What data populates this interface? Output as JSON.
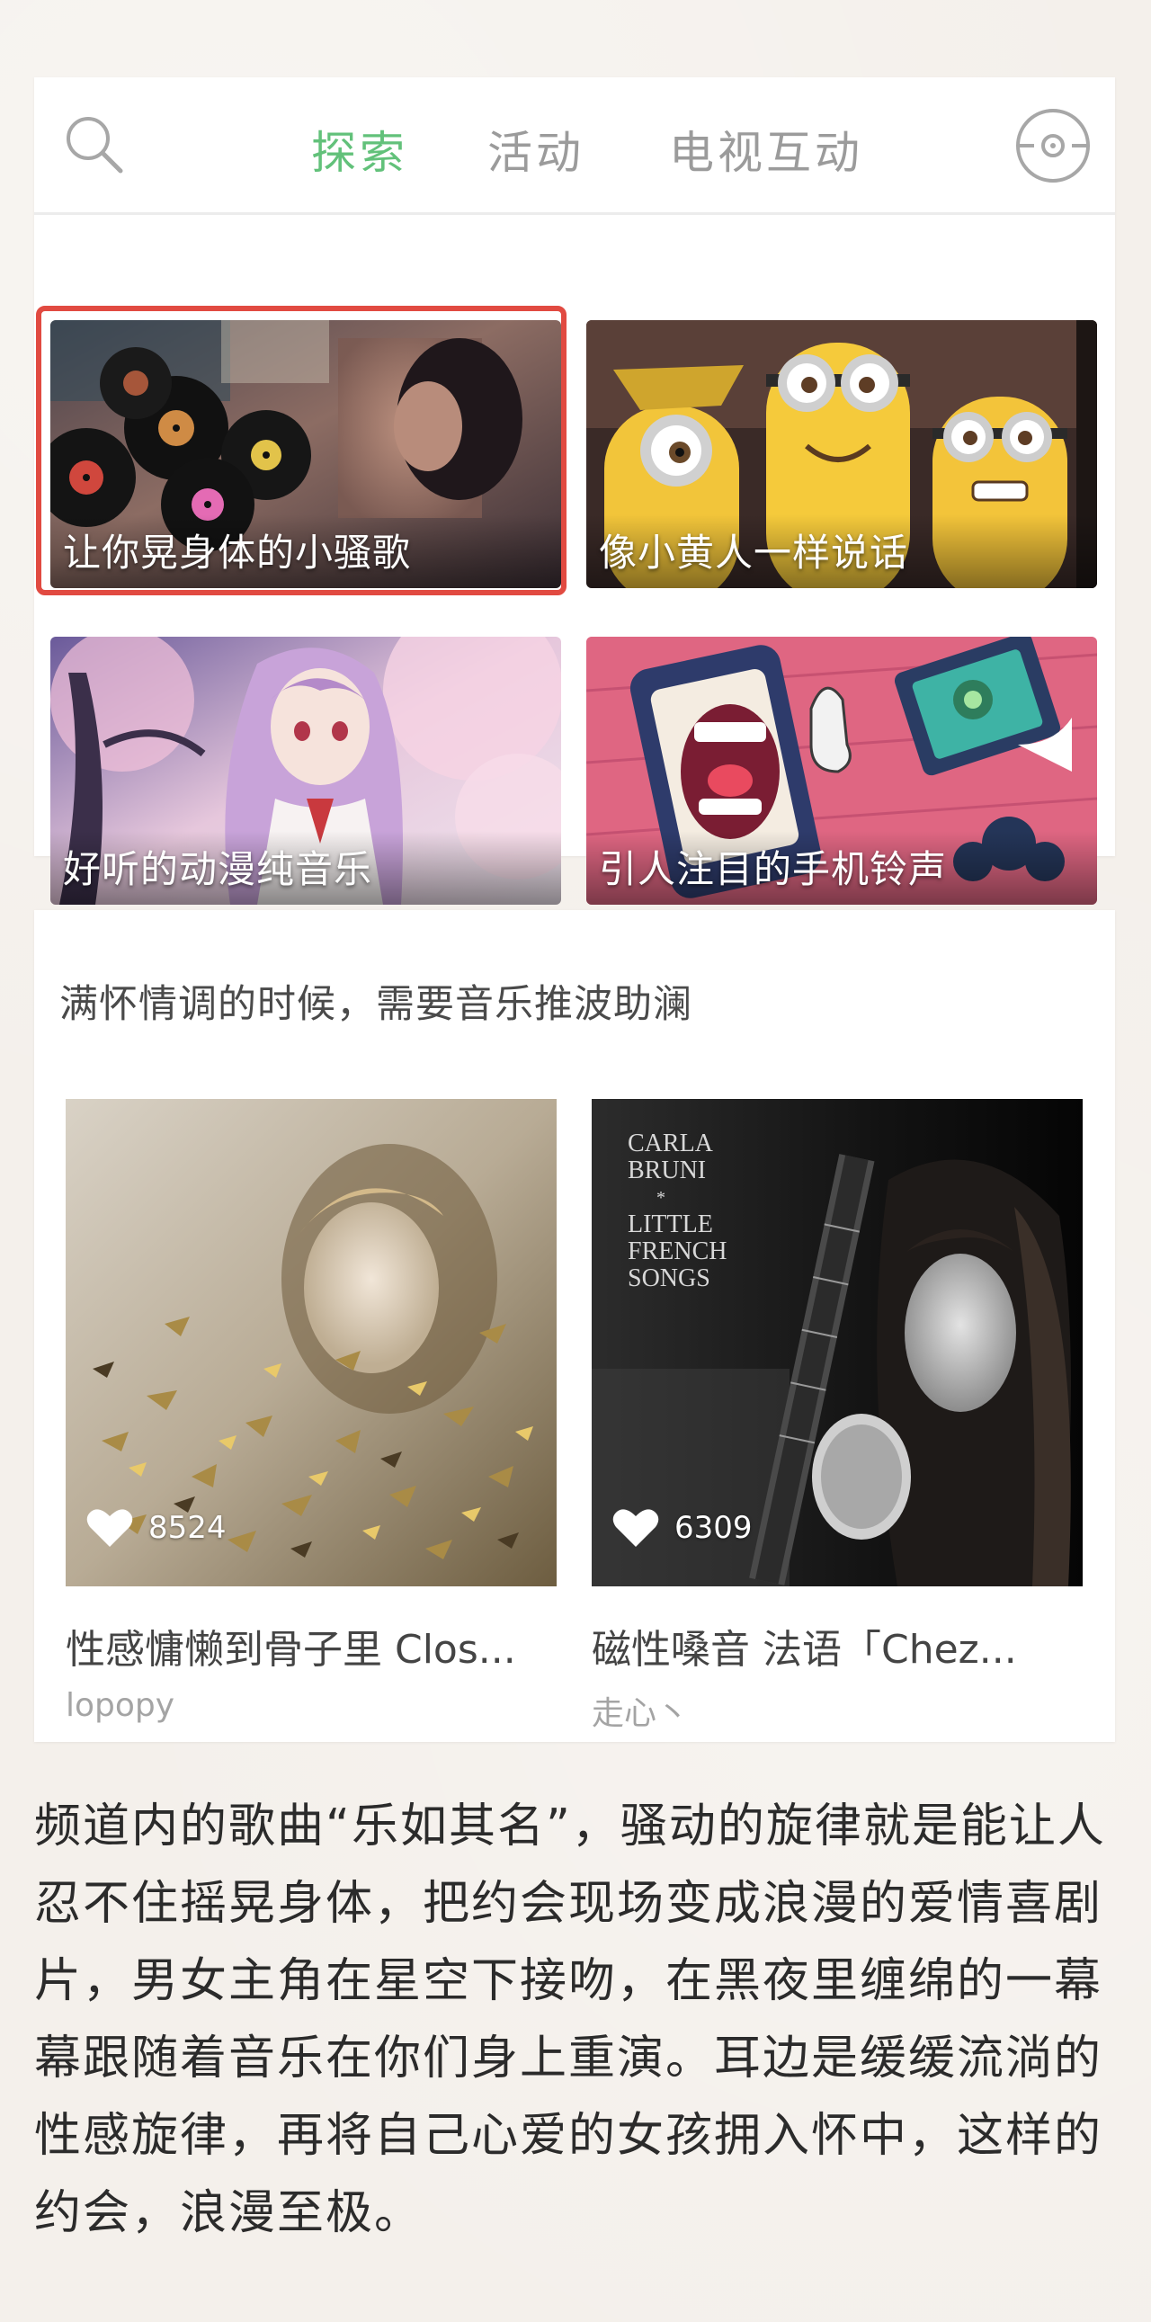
{
  "nav": {
    "tabs": [
      {
        "label": "探索",
        "active": true
      },
      {
        "label": "活动",
        "active": false
      },
      {
        "label": "电视互动",
        "active": false
      }
    ],
    "accent_color": "#62c17a",
    "icons": {
      "search": "search-icon",
      "disc": "disc-icon"
    }
  },
  "banners": [
    {
      "caption": "让你晃身体的小骚歌",
      "selected": true
    },
    {
      "caption": "像小黄人一样说话",
      "selected": false
    },
    {
      "caption": "好听的动漫纯音乐",
      "selected": false
    },
    {
      "caption": "引人注目的手机铃声",
      "selected": false
    }
  ],
  "selection_color": "#e14a41",
  "playlist_section": {
    "title": "满怀情调的时候，需要音乐推波助澜",
    "albums": [
      {
        "likes": "8524",
        "title": "性感慵懒到骨子里 Clos...",
        "author": "lopopy"
      },
      {
        "likes": "6309",
        "title": "磁性嗓音 法语「Chez...",
        "author": "走心丶",
        "cover_text": {
          "line1": "CARLA",
          "line2": "BRUNI",
          "star": "*",
          "line3": "LITTLE",
          "line4": "FRENCH",
          "line5": "SONGS"
        }
      }
    ]
  },
  "article": {
    "text": "频道内的歌曲“乐如其名”，骚动的旋律就是能让人忍不住摇晃身体，把约会现场变成浪漫的爱情喜剧片，男女主角在星空下接吻，在黑夜里缠绵的一幕幕跟随着音乐在你们身上重演。耳边是缓缓流淌的性感旋律，再将自己心爱的女孩拥入怀中，这样的约会，浪漫至极。"
  }
}
